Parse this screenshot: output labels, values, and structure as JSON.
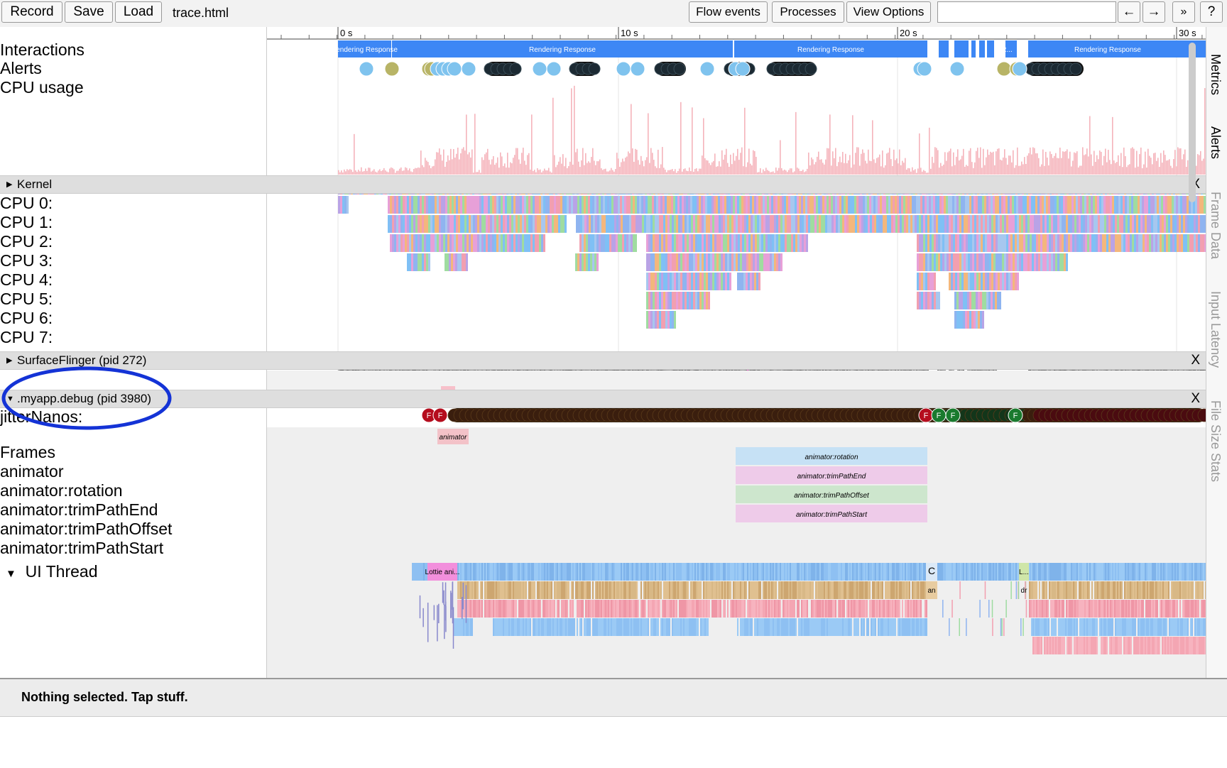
{
  "toolbar": {
    "record": "Record",
    "save": "Save",
    "load": "Load",
    "filename": "trace.html",
    "flow_events": "Flow events",
    "processes": "Processes",
    "view_options": "View Options",
    "search_value": "",
    "prev": "←",
    "next": "→",
    "more": "»",
    "help": "?"
  },
  "ruler": {
    "ticks": [
      "0 s",
      "10 s",
      "20 s",
      "30 s"
    ]
  },
  "tracks": {
    "interactions": "Interactions",
    "alerts": "Alerts",
    "cpu_usage": "CPU usage",
    "cpus": [
      "CPU 0:",
      "CPU 1:",
      "CPU 2:",
      "CPU 3:",
      "CPU 4:",
      "CPU 5:",
      "CPU 6:",
      "CPU 7:"
    ],
    "jitter": "jitterNanos:",
    "frames": "Frames",
    "animator": "animator",
    "rotation": "animator:rotation",
    "trim_end": "animator:trimPathEnd",
    "trim_offset": "animator:trimPathOffset",
    "trim_start": "animator:trimPathStart",
    "ui_thread": "UI Thread"
  },
  "groups": {
    "kernel": "Kernel",
    "surfaceflinger": "SurfaceFlinger (pid 272)",
    "myapp": ".myapp.debug (pid 3980)",
    "close": "X"
  },
  "slices": {
    "rendering_response": "Rendering Response",
    "r_short": "R...",
    "animator": "animator",
    "rotation": "animator:rotation",
    "trim_end": "animator:trimPathEnd",
    "trim_offset": "animator:trimPathOffset",
    "trim_start": "animator:trimPathStart",
    "lottie": "Lottie ani...",
    "c": "C",
    "an": "an",
    "l_dots": "L...",
    "dr": "dr",
    "frame_f": "F"
  },
  "side_tabs": [
    "Metrics",
    "Alerts",
    "Frame Data",
    "Input Latency",
    "File Size Stats"
  ],
  "status": {
    "message": "Nothing selected. Tap stuff."
  },
  "colors": {
    "interaction_blue": "#3d87f5",
    "cpu_pink": "#f5b3bb",
    "alert_blue": "#7fc3ee",
    "alert_olive": "#b8b466",
    "frame_red": "#b50d1e",
    "frame_green": "#1a7a2e",
    "rotation_blue": "#c6e1f5",
    "trim_pink": "#eecbe9",
    "trim_green": "#cde6cd",
    "ui_blue": "#8ec0f2",
    "ui_tan": "#d8b886",
    "ui_pink": "#f4a6b3",
    "annotation_circle": "#1433d6"
  }
}
